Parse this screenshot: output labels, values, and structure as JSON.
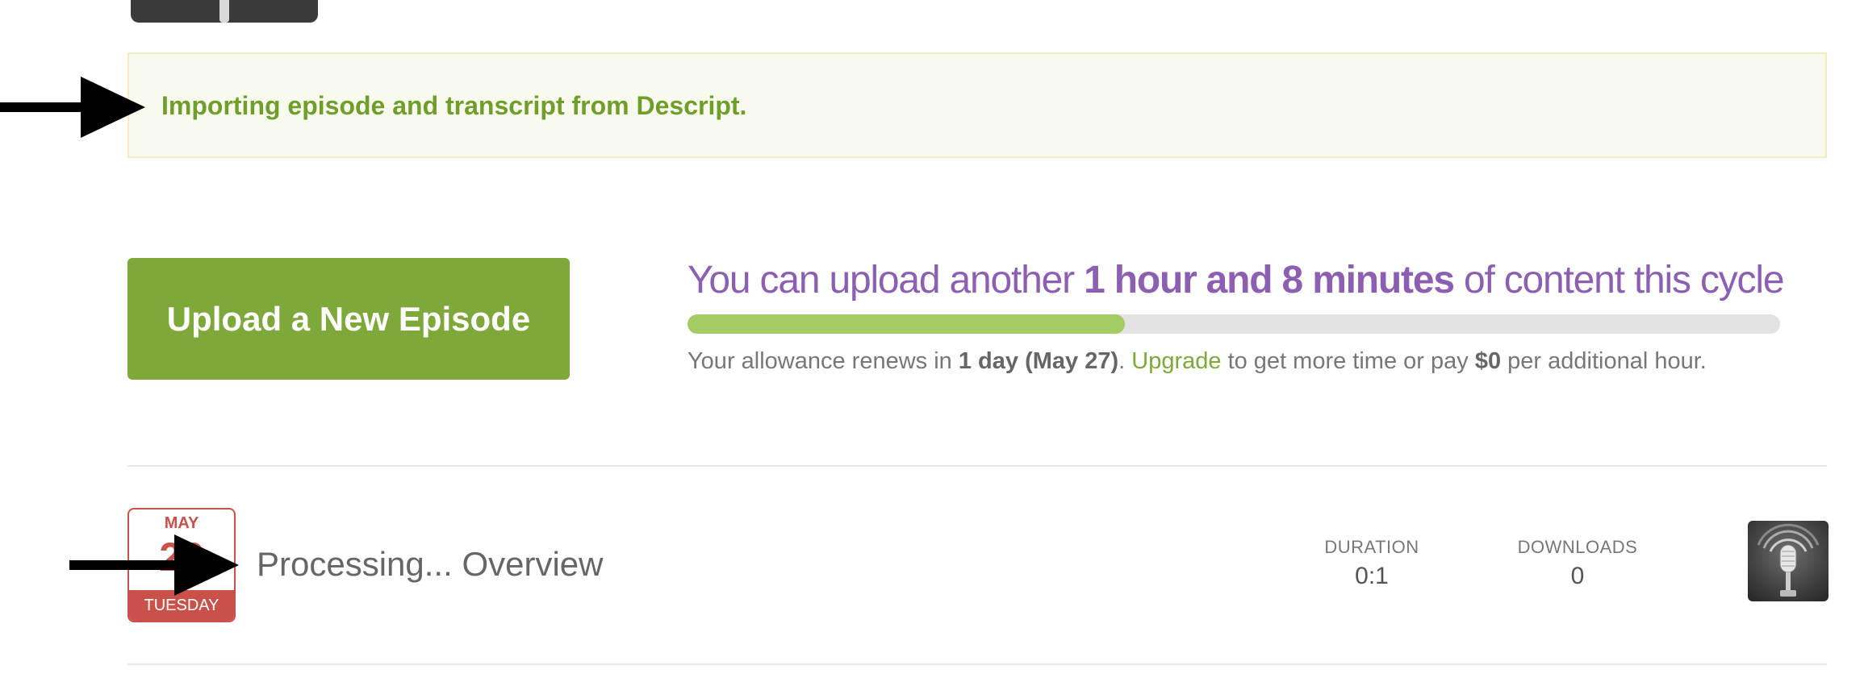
{
  "notice": {
    "text": "Importing episode and transcript from Descript."
  },
  "upload": {
    "button_label": "Upload a New Episode"
  },
  "allowance": {
    "heading_prefix": "You can upload another",
    "heading_amount": "1 hour and 8 minutes",
    "heading_suffix": "of content this cycle",
    "progress_fraction": 0.4,
    "sub_prefix": "Your allowance renews in",
    "sub_renewal": "1 day (May 27)",
    "sub_period": ".",
    "upgrade_link": "Upgrade",
    "sub_middle": "to get more time or pay",
    "sub_price": "$0",
    "sub_suffix": "per additional hour."
  },
  "episode": {
    "date_month": "MAY",
    "date_day": "26",
    "date_weekday": "TUESDAY",
    "title": "Processing... Overview",
    "duration_label": "DURATION",
    "duration_value": "0:1",
    "downloads_label": "DOWNLOADS",
    "downloads_value": "0",
    "artwork_icon": "microphone-icon"
  },
  "colors": {
    "accent_green": "#7ea83a",
    "notice_text": "#6f9e2a",
    "allowance_purple": "#8c5fb3",
    "date_red": "#c9514a"
  }
}
